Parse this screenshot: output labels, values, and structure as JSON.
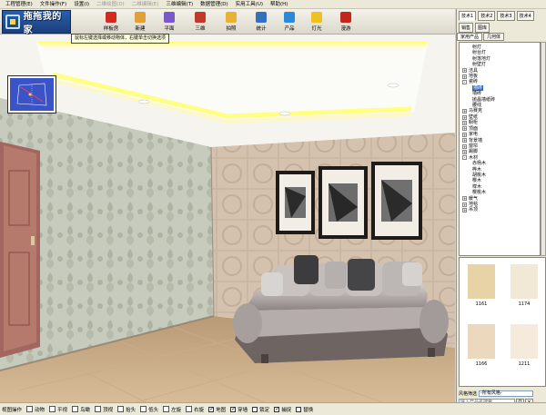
{
  "menu": [
    {
      "label": "工程管理(E)",
      "disabled": false
    },
    {
      "label": "文件操作(F)",
      "disabled": false
    },
    {
      "label": "设置(I)",
      "disabled": false
    },
    {
      "label": "二维绘图(D)",
      "disabled": true
    },
    {
      "label": "二维编辑(E)",
      "disabled": true
    },
    {
      "label": "三维编辑(T)",
      "disabled": false
    },
    {
      "label": "数据管理(D)",
      "disabled": false
    },
    {
      "label": "实用工具(U)",
      "disabled": false
    },
    {
      "label": "帮助(H)",
      "disabled": false
    }
  ],
  "logo": {
    "text": "拖拖我的家"
  },
  "toolbar": [
    {
      "label": "样板房",
      "icon": "flag-icon",
      "color": "#d32a20"
    },
    {
      "label": "新建",
      "icon": "new-folder-icon",
      "color": "#e0a13a"
    },
    {
      "label": "平面",
      "icon": "plan-icon",
      "color": "#7a58c9"
    },
    {
      "label": "三维",
      "icon": "house-3d-icon",
      "color": "#c0392b"
    },
    {
      "label": "拍照",
      "icon": "camera-icon",
      "color": "#e6b432"
    },
    {
      "label": "统计",
      "icon": "chart-icon",
      "color": "#3470c0"
    },
    {
      "label": "产品",
      "icon": "globe-icon",
      "color": "#2b8ad8"
    },
    {
      "label": "灯光",
      "icon": "bulb-icon",
      "color": "#f0c020"
    },
    {
      "label": "漫游",
      "icon": "walk-icon",
      "color": "#c0281c"
    }
  ],
  "hint": "鼠标左键选择或移动物体，右键单击切换选项",
  "right_panel": {
    "top_tabs": [
      "技术1",
      "技术2",
      "技术3",
      "技术4",
      "销售",
      "图库"
    ],
    "category_tabs": [
      "家用产品",
      "几何体"
    ],
    "tree": [
      {
        "level": 2,
        "label": "射灯",
        "expand": ""
      },
      {
        "level": 2,
        "label": "射台灯",
        "expand": ""
      },
      {
        "level": 2,
        "label": "射落地灯",
        "expand": ""
      },
      {
        "level": 2,
        "label": "射壁灯",
        "expand": ""
      },
      {
        "level": 1,
        "label": "洁具",
        "expand": "+"
      },
      {
        "level": 1,
        "label": "地板",
        "expand": "+"
      },
      {
        "level": 1,
        "label": "瓷砖",
        "expand": "-"
      },
      {
        "level": 2,
        "label": "墙砖",
        "expand": "",
        "selected": true
      },
      {
        "level": 2,
        "label": "墙砖",
        "expand": ""
      },
      {
        "level": 2,
        "label": "抛晶墙纸砖",
        "expand": ""
      },
      {
        "level": 2,
        "label": "腰线",
        "expand": ""
      },
      {
        "level": 1,
        "label": "马赛克",
        "expand": "+"
      },
      {
        "level": 1,
        "label": "壁纸",
        "expand": "+"
      },
      {
        "level": 1,
        "label": "橱柜",
        "expand": "+"
      },
      {
        "level": 1,
        "label": "顶面",
        "expand": "+"
      },
      {
        "level": 1,
        "label": "家电",
        "expand": "+"
      },
      {
        "level": 1,
        "label": "背景墙",
        "expand": "+"
      },
      {
        "level": 1,
        "label": "窗帘",
        "expand": "+"
      },
      {
        "level": 1,
        "label": "踢脚",
        "expand": "+"
      },
      {
        "level": 1,
        "label": "木材",
        "expand": "-"
      },
      {
        "level": 2,
        "label": "赤杨木",
        "expand": ""
      },
      {
        "level": 2,
        "label": "桦木",
        "expand": ""
      },
      {
        "level": 2,
        "label": "胡桃木",
        "expand": ""
      },
      {
        "level": 2,
        "label": "樱木",
        "expand": ""
      },
      {
        "level": 2,
        "label": "榉木",
        "expand": ""
      },
      {
        "level": 2,
        "label": "樱桃木",
        "expand": ""
      },
      {
        "level": 1,
        "label": "暖气",
        "expand": "+"
      },
      {
        "level": 1,
        "label": "地毯",
        "expand": "+"
      },
      {
        "level": 1,
        "label": "吊顶",
        "expand": "+"
      }
    ],
    "thumbnails": [
      {
        "code": "1161",
        "color": "#e7d3a6"
      },
      {
        "code": "1174",
        "color": "#f1e8d6"
      },
      {
        "code": "1166",
        "color": "#ecd9bd"
      },
      {
        "code": "1211",
        "color": "#f5eadb"
      }
    ],
    "style_filter": {
      "label": "风格筛选",
      "value": "-所有风格-"
    },
    "search": {
      "placeholder": "输入产品名搜索",
      "btn_go": "Q",
      "btn_clear": "×"
    }
  },
  "bottom_bar": {
    "items": [
      {
        "label": "视图操作",
        "kind": "text"
      },
      {
        "label": "动物",
        "kind": "icon"
      },
      {
        "label": "平视",
        "kind": "icon"
      },
      {
        "label": "鸟瞰",
        "kind": "icon"
      },
      {
        "label": "顶视",
        "kind": "icon"
      },
      {
        "label": "抬头",
        "kind": "icon"
      },
      {
        "label": "低头",
        "kind": "icon"
      },
      {
        "label": "左旋",
        "kind": "icon"
      },
      {
        "label": "右旋",
        "kind": "icon"
      }
    ],
    "checks": [
      {
        "label": "地图",
        "checked": true
      },
      {
        "label": "穿墙",
        "checked": true
      },
      {
        "label": "锁定",
        "checked": false
      },
      {
        "label": "捕捉",
        "checked": true
      },
      {
        "label": "替换",
        "checked": false
      }
    ]
  }
}
